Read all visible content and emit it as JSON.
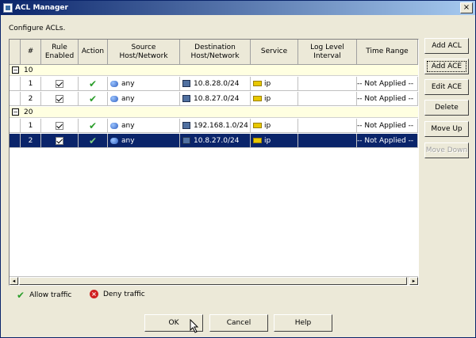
{
  "window": {
    "title": "ACL Manager",
    "close_glyph": "×"
  },
  "configure_label": "Configure ACLs.",
  "table": {
    "headers": [
      "#",
      "Rule Enabled",
      "Action",
      "Source Host/Network",
      "Destination Host/Network",
      "Service",
      "Log Level Interval",
      "Time Range"
    ],
    "groups": [
      {
        "name": "10",
        "toggle": "−",
        "rows": [
          {
            "num": "1",
            "enabled": true,
            "action": "✔",
            "source": "any",
            "destination": "10.8.28.0/24",
            "service": "ip",
            "log": "",
            "time": "-- Not Applied --",
            "selected": false
          },
          {
            "num": "2",
            "enabled": true,
            "action": "✔",
            "source": "any",
            "destination": "10.8.27.0/24",
            "service": "ip",
            "log": "",
            "time": "-- Not Applied --",
            "selected": false
          }
        ]
      },
      {
        "name": "20",
        "toggle": "−",
        "rows": [
          {
            "num": "1",
            "enabled": true,
            "action": "✔",
            "source": "any",
            "destination": "192.168.1.0/24",
            "service": "ip",
            "log": "",
            "time": "-- Not Applied --",
            "selected": false
          },
          {
            "num": "2",
            "enabled": true,
            "action": "✔",
            "source": "any",
            "destination": "10.8.27.0/24",
            "service": "ip",
            "log": "",
            "time": "-- Not Applied --",
            "selected": true
          }
        ]
      }
    ]
  },
  "side_buttons": {
    "add_acl": "Add ACL",
    "add_ace": "Add ACE",
    "edit_ace": "Edit ACE",
    "delete": "Delete",
    "move_up": "Move Up",
    "move_down": "Move Down"
  },
  "legend": {
    "allow": "Allow traffic",
    "allow_glyph": "✔",
    "deny": "Deny traffic",
    "deny_glyph": "×"
  },
  "buttons": {
    "ok": "OK",
    "cancel": "Cancel",
    "help": "Help"
  },
  "scroll": {
    "left": "◂",
    "right": "▸"
  },
  "colors": {
    "selection": "#0a246a",
    "group_bg": "#ffffe1",
    "allow": "#2a9d2a",
    "deny": "#d02020"
  }
}
